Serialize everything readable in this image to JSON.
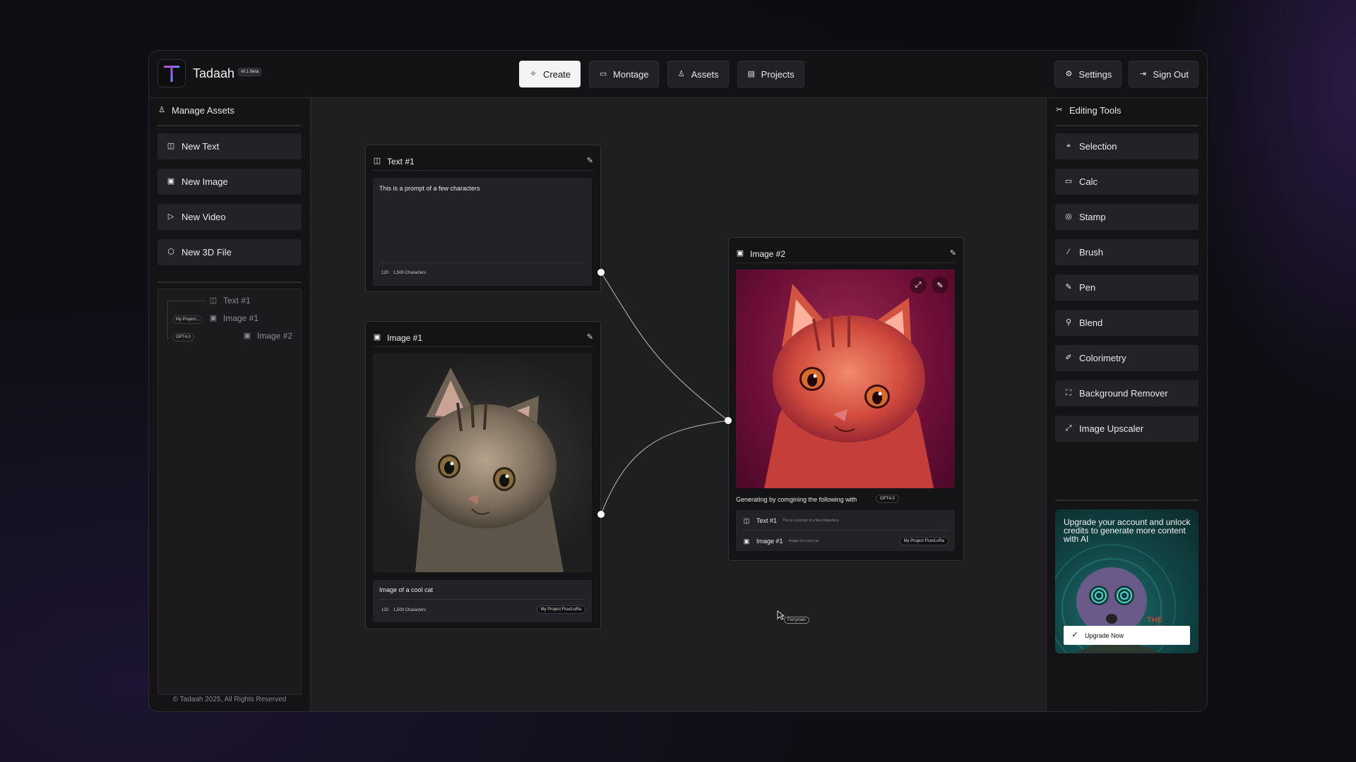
{
  "app": {
    "name": "Tadaah",
    "version_badge": "v0.1 Beta"
  },
  "nav": {
    "tabs": [
      {
        "label": "Create",
        "icon": "sparkles-icon",
        "active": true
      },
      {
        "label": "Montage",
        "icon": "video-icon",
        "active": false
      },
      {
        "label": "Assets",
        "icon": "user-icon",
        "active": false
      },
      {
        "label": "Projects",
        "icon": "film-icon",
        "active": false
      }
    ],
    "settings_label": "Settings",
    "signout_label": "Sign Out"
  },
  "left_panel": {
    "title": "Manage Assets",
    "buttons": [
      {
        "label": "New Text",
        "icon": "message-icon"
      },
      {
        "label": "New Image",
        "icon": "image-icon"
      },
      {
        "label": "New Video",
        "icon": "play-icon"
      },
      {
        "label": "New 3D File",
        "icon": "cube-icon"
      }
    ],
    "tree": {
      "items": [
        "Text #1",
        "Image #1",
        "Image #2"
      ],
      "project_tag": "My Project...",
      "model_tag": "GPT4.0"
    },
    "copyright": "© Tadaah 2025, All Rights Reserved"
  },
  "right_panel": {
    "title": "Editing Tools",
    "tools": [
      {
        "label": "Selection",
        "icon": "pointer-icon"
      },
      {
        "label": "Calc",
        "icon": "layers-icon"
      },
      {
        "label": "Stamp",
        "icon": "stamp-icon"
      },
      {
        "label": "Brush",
        "icon": "brush-icon"
      },
      {
        "label": "Pen",
        "icon": "pen-icon"
      },
      {
        "label": "Blend",
        "icon": "blend-icon"
      },
      {
        "label": "Colorimetry",
        "icon": "dropper-icon"
      },
      {
        "label": "Background Remover",
        "icon": "scan-icon"
      },
      {
        "label": "Image Upscaler",
        "icon": "expand-icon"
      }
    ],
    "promo": {
      "text": "Upgrade your account and unlock credits to generate more content with AI",
      "button": "Upgrade Now"
    }
  },
  "canvas": {
    "text_node": {
      "title": "Text #1",
      "prompt": "This is a prompt of a few characters",
      "count": "120",
      "limit": "1,500 Characters"
    },
    "image1_node": {
      "title": "Image #1",
      "caption": "Image of a cool cat",
      "count": "120",
      "limit": "1,500 Characters",
      "tag": "My Project Flux/LoRa"
    },
    "image2_node": {
      "title": "Image #2",
      "generating_label": "Generating by comgining the following with",
      "model": "GPT4.0",
      "inputs": [
        {
          "title": "Text #1",
          "desc": "This is a prompt of a few characters."
        },
        {
          "title": "Image #1",
          "desc": "Image of a cool cat",
          "tag": "My Project Flux/LoRa"
        }
      ]
    },
    "cursor_label": "Ferryman"
  }
}
